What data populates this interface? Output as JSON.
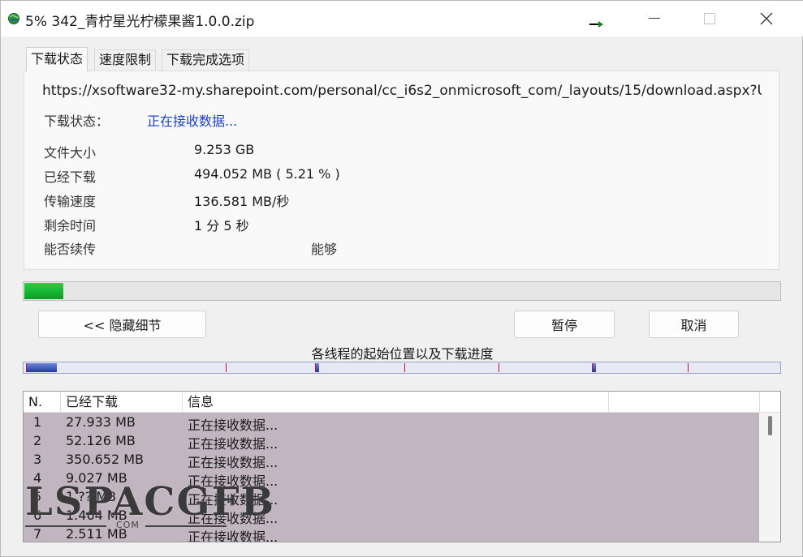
{
  "window": {
    "title": "5% 342_青柠星光柠檬果酱1.0.0.zip",
    "controls": {
      "minimize": "minimize-icon",
      "maximize": "maximize-icon",
      "close": "close-icon"
    }
  },
  "tabs": [
    {
      "label": "下载状态",
      "active": true
    },
    {
      "label": "速度限制",
      "active": false
    },
    {
      "label": "下载完成选项",
      "active": false
    }
  ],
  "status_panel": {
    "url": "https://xsoftware32-my.sharepoint.com/personal/cc_i6s2_onmicrosoft_com/_layouts/15/download.aspx?UniqueI",
    "status_label": "下载状态：",
    "status_value": "正在接收数据...",
    "rows": [
      {
        "label": "文件大小",
        "value": "9.253 GB"
      },
      {
        "label": "已经下载",
        "value": "494.052 MB ( 5.21 % )"
      },
      {
        "label": "传输速度",
        "value": "136.581 MB/秒"
      },
      {
        "label": "剩余时间",
        "value": "1 分 5 秒"
      }
    ],
    "resume_label": "能否续传",
    "resume_value": "能够"
  },
  "progress": {
    "percent": 5.21,
    "color": "#06b025"
  },
  "buttons": {
    "hide_details": "<< 隐藏细节",
    "pause": "暂停",
    "cancel": "取消"
  },
  "threads": {
    "caption": "各线程的起始位置以及下载进度",
    "divider_color": "#c8102e",
    "progress_color": "#1f39a8"
  },
  "thread_list": {
    "columns": [
      "N.",
      "已经下载",
      "信息"
    ],
    "rows": [
      {
        "n": "1",
        "downloaded": "27.933 MB",
        "info": "正在接收数据..."
      },
      {
        "n": "2",
        "downloaded": "52.126 MB",
        "info": "正在接收数据..."
      },
      {
        "n": "3",
        "downloaded": "350.652 MB",
        "info": "正在接收数据..."
      },
      {
        "n": "4",
        "downloaded": "9.027 MB",
        "info": "正在接收数据..."
      },
      {
        "n": "5",
        "downloaded": "1.?? MB",
        "info": "正在接收数据..."
      },
      {
        "n": "6",
        "downloaded": "1.464 MB",
        "info": "正在接收数据..."
      },
      {
        "n": "7",
        "downloaded": "2.511 MB",
        "info": "正在接收数据..."
      }
    ],
    "row_background": "#c1b5bf"
  },
  "watermark": {
    "text": "LSPACGFB",
    "sub": "COM"
  }
}
